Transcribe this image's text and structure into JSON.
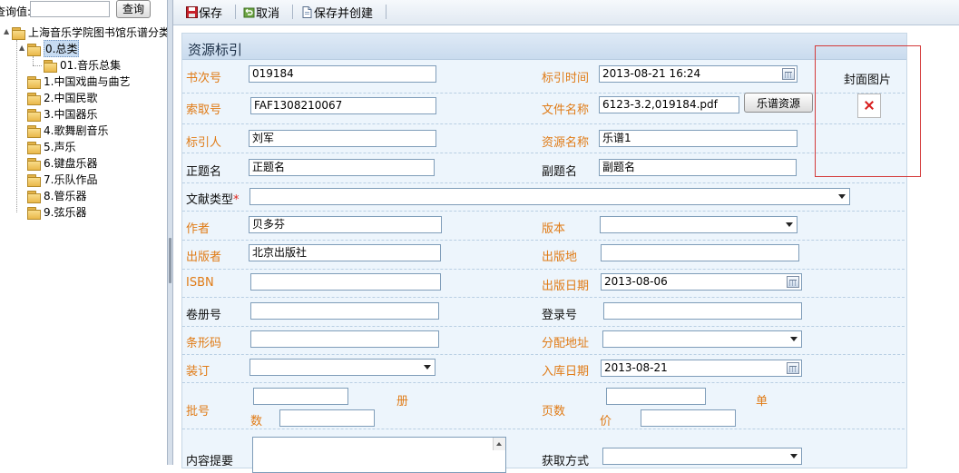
{
  "left": {
    "search_label": "查询值:",
    "search_value": "",
    "search_button": "查询",
    "tree_root": "上海音乐学院图书馆乐谱分类",
    "tree_items": [
      {
        "label": "0.总类"
      },
      {
        "label": "01.音乐总集"
      },
      {
        "label": "1.中国戏曲与曲艺"
      },
      {
        "label": "2.中国民歌"
      },
      {
        "label": "3.中国器乐"
      },
      {
        "label": "4.歌舞剧音乐"
      },
      {
        "label": "5.声乐"
      },
      {
        "label": "6.键盘乐器"
      },
      {
        "label": "7.乐队作品"
      },
      {
        "label": "8.管乐器"
      },
      {
        "label": "9.弦乐器"
      }
    ]
  },
  "toolbar": {
    "save": "保存",
    "cancel": "取消",
    "save_and_create": "保存并创建"
  },
  "panel": {
    "title": "资源标引",
    "cover_label": "封面图片",
    "fields": {
      "call_no": {
        "label": "书次号",
        "value": "019184"
      },
      "index_time": {
        "label": "标引时间",
        "value": "2013-08-21 16:24"
      },
      "request_no": {
        "label": "索取号",
        "value": "FAF1308210067"
      },
      "file_name": {
        "label": "文件名称",
        "value": "6123-3.2,019184.pdf"
      },
      "score_resource_button": "乐谱资源",
      "indexer": {
        "label": "标引人",
        "value": "刘军"
      },
      "resource_name": {
        "label": "资源名称",
        "value": "乐谱1"
      },
      "main_title": {
        "label": "正题名",
        "value": "正题名"
      },
      "sub_title": {
        "label": "副题名",
        "value": "副题名"
      },
      "doc_type": {
        "label": "文献类型",
        "required_mark": "*",
        "value": ""
      },
      "author": {
        "label": "作者",
        "value": "贝多芬"
      },
      "edition": {
        "label": "版本",
        "value": ""
      },
      "publisher": {
        "label": "出版者",
        "value": "北京出版社"
      },
      "pub_place": {
        "label": "出版地",
        "value": ""
      },
      "isbn": {
        "label": "ISBN",
        "value": ""
      },
      "pub_date": {
        "label": "出版日期",
        "value": "2013-08-06"
      },
      "volume": {
        "label": "卷册号",
        "value": ""
      },
      "register_no": {
        "label": "登录号",
        "value": ""
      },
      "barcode": {
        "label": "条形码",
        "value": ""
      },
      "alloc_addr": {
        "label": "分配地址",
        "value": ""
      },
      "binding": {
        "label": "装订",
        "value": ""
      },
      "storage_date": {
        "label": "入库日期",
        "value": "2013-08-21"
      },
      "batch_no": {
        "label": "批号",
        "value": "",
        "count_value": ""
      },
      "volume_count_label_1": "册",
      "volume_count_label_2": "数",
      "pages": {
        "label": "页数",
        "value": "",
        "price_value": ""
      },
      "unit_price_label_1": "单",
      "unit_price_label_2": "价",
      "summary": {
        "label": "内容提要",
        "value": ""
      },
      "acquisition": {
        "label": "获取方式",
        "value": ""
      }
    }
  },
  "colors": {
    "label_orange": "#e07b16",
    "panel_bg": "#edf5fc",
    "cover_border": "#d43a3a"
  }
}
